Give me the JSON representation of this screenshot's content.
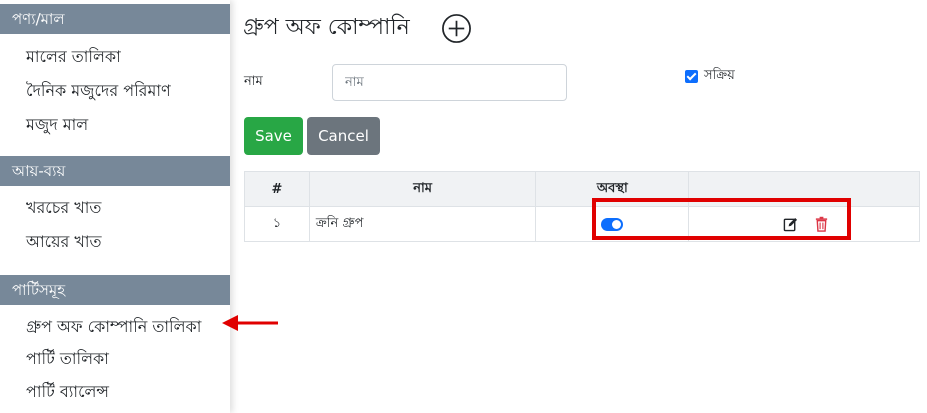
{
  "sidebar": {
    "sections": [
      {
        "title": "পণ্য/মাল",
        "items": [
          "মালের তালিকা",
          "দৈনিক মজুদের পরিমাণ",
          "মজুদ মাল"
        ]
      },
      {
        "title": "আয়-ব্যয়",
        "items": [
          "খরচের খাত",
          "আয়ের খাত"
        ]
      },
      {
        "title": "পার্টিসমূহ",
        "items": [
          "গ্রুপ অফ কোম্পানি তালিকা",
          "পার্টি তালিকা",
          "পার্টি ব্যালেন্স"
        ]
      }
    ]
  },
  "main": {
    "title": "গ্রুপ অফ কোম্পানি",
    "add_icon": "plus-circle-icon",
    "form": {
      "name_label": "নাম",
      "name_placeholder": "নাম",
      "name_value": "",
      "active_label": "সক্রিয়",
      "active_checked": true,
      "save_label": "Save",
      "cancel_label": "Cancel"
    },
    "table": {
      "headers": [
        "#",
        "নাম",
        "অবস্থা",
        ""
      ],
      "rows": [
        {
          "num": "১",
          "name": "ক্রনি গ্রুপ",
          "status_on": true,
          "edit_icon": "pencil-square-icon",
          "delete_icon": "trash-icon"
        }
      ]
    }
  },
  "colors": {
    "sidebar_header": "#778899",
    "save": "#28a745",
    "cancel": "#6c757d",
    "accent": "#0d6efd",
    "highlight": "#e00000",
    "delete": "#dc3545"
  }
}
